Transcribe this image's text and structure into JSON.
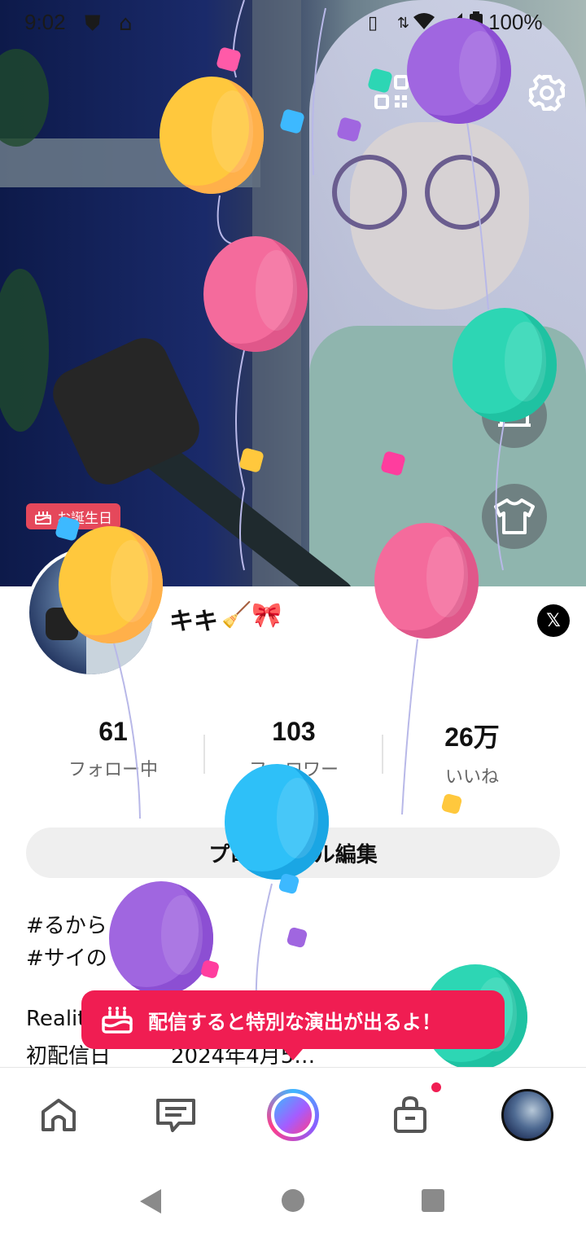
{
  "status_bar": {
    "time": "9:02",
    "battery": "100%",
    "network": "5"
  },
  "hero": {
    "birthday_badge": "お誕生日",
    "icons": [
      "qr-code-icon",
      "settings-gear-icon",
      "room-icon",
      "tshirt-closet-icon"
    ]
  },
  "profile": {
    "name": "キキ",
    "name_emoji": "🧹🎀",
    "x_link": "𝕏",
    "stats": [
      {
        "value": "61",
        "label": "フォロー中"
      },
      {
        "value": "103",
        "label": "フォロワー"
      },
      {
        "value": "26万",
        "label": "いいね"
      }
    ],
    "edit_button": "プロフィール編集",
    "bio": {
      "line1": "#るから",
      "line2": "#サイの",
      "line3": "Realit",
      "first_stream_label": "初配信日",
      "first_stream_value": "2024年4月5…"
    }
  },
  "tooltip": {
    "text": "配信すると特別な演出が出るよ！"
  },
  "bottom_nav": {
    "items": [
      "home-icon",
      "chat-icon",
      "go-live-icon",
      "shop-icon",
      "my-profile-avatar"
    ]
  },
  "colors": {
    "accent": "#f01d52",
    "badge": "#e5485b",
    "button_bg": "#efefef"
  }
}
